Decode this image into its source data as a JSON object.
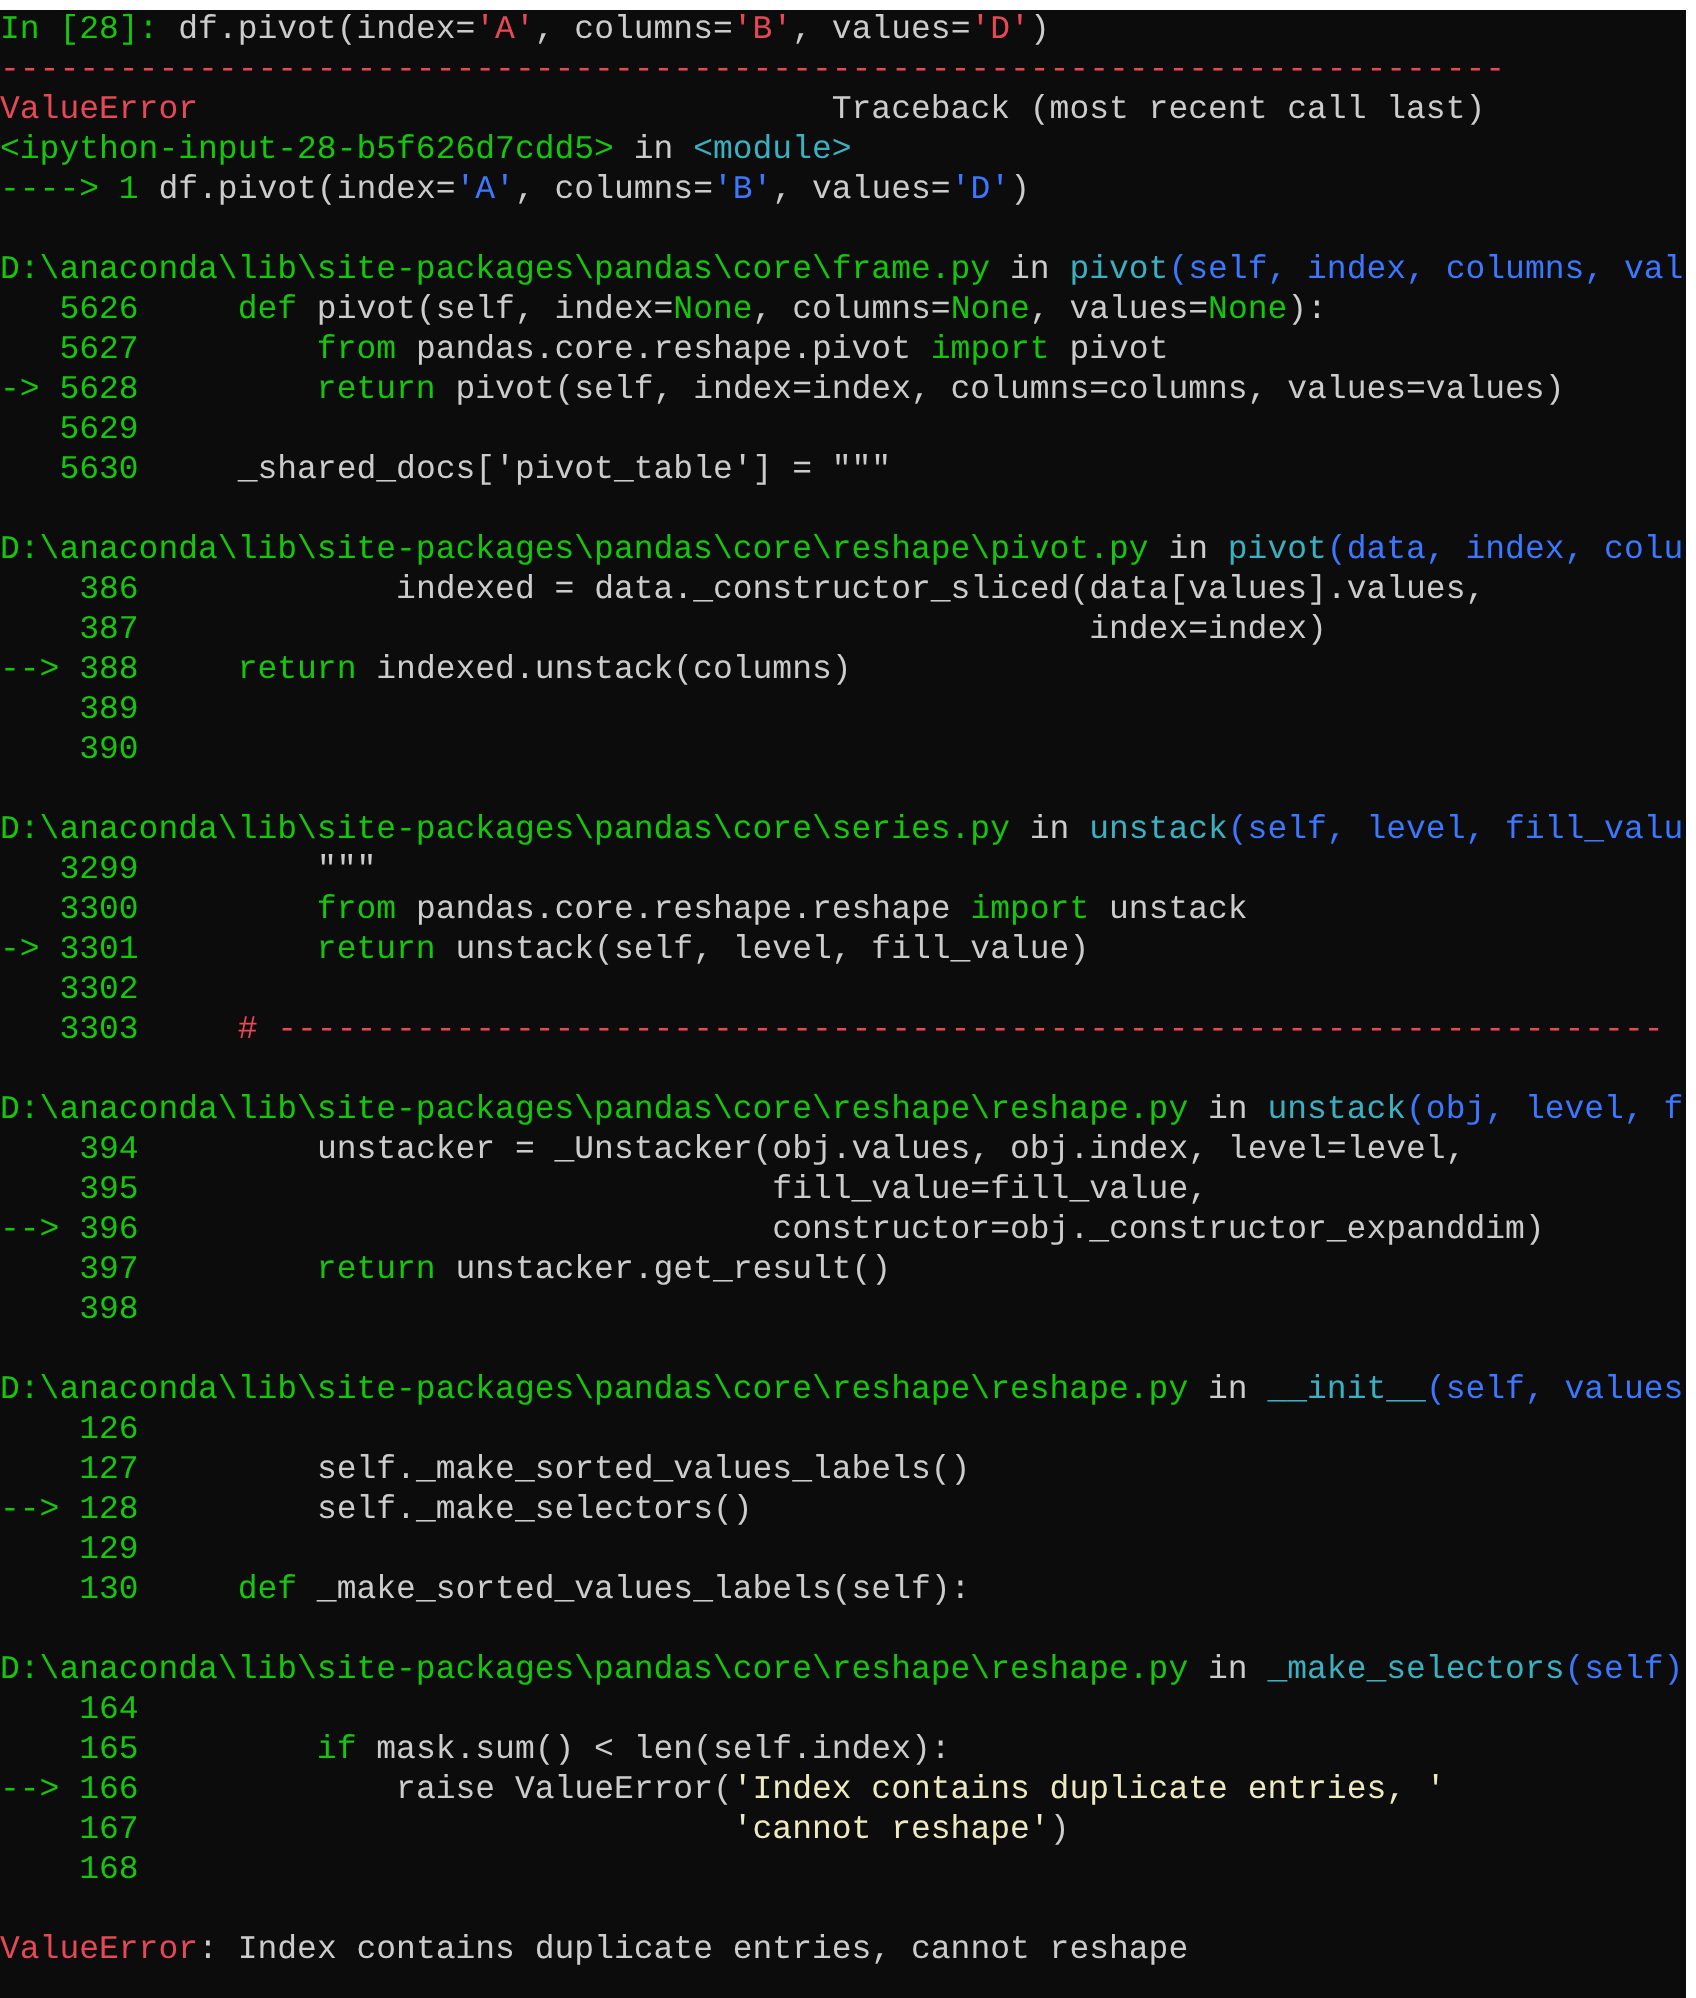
{
  "console": {
    "lines": [
      {
        "kind": "text",
        "segments": [
          {
            "kind": "prompt",
            "text": "In [28]: "
          },
          {
            "kind": "plain",
            "text": "df.pivot(index="
          },
          {
            "kind": "error",
            "text": "'A'"
          },
          {
            "kind": "plain",
            "text": ", columns="
          },
          {
            "kind": "error",
            "text": "'B'"
          },
          {
            "kind": "plain",
            "text": ", values="
          },
          {
            "kind": "error",
            "text": "'D'"
          },
          {
            "kind": "plain",
            "text": ")"
          }
        ]
      },
      {
        "kind": "text",
        "segments": [
          {
            "kind": "error",
            "text": "----------------------------------------------------------------------------"
          }
        ]
      },
      {
        "kind": "text",
        "segments": [
          {
            "kind": "error",
            "text": "ValueError"
          },
          {
            "kind": "plain",
            "text": "                                Traceback (most recent call last)"
          }
        ]
      },
      {
        "kind": "text",
        "segments": [
          {
            "kind": "path",
            "text": "<ipython-input-28-b5f626d7cdd5>"
          },
          {
            "kind": "plain",
            "text": " in "
          },
          {
            "kind": "function",
            "text": "<module>"
          }
        ]
      },
      {
        "kind": "text",
        "segments": [
          {
            "kind": "path",
            "text": "----> 1 "
          },
          {
            "kind": "plain",
            "text": "df.pivot(index="
          },
          {
            "kind": "args",
            "text": "'A'"
          },
          {
            "kind": "plain",
            "text": ", columns="
          },
          {
            "kind": "args",
            "text": "'B'"
          },
          {
            "kind": "plain",
            "text": ", values="
          },
          {
            "kind": "args",
            "text": "'D'"
          },
          {
            "kind": "plain",
            "text": ")"
          }
        ]
      },
      {
        "kind": "blank"
      },
      {
        "kind": "text",
        "segments": [
          {
            "kind": "path",
            "text": "D:\\anaconda\\lib\\site-packages\\pandas\\core\\frame.py"
          },
          {
            "kind": "plain",
            "text": " in "
          },
          {
            "kind": "function",
            "text": "pivot"
          },
          {
            "kind": "args",
            "text": "(self, index, columns, val"
          }
        ]
      },
      {
        "kind": "text",
        "segments": [
          {
            "kind": "path",
            "text": "   5626     def"
          },
          {
            "kind": "plain",
            "text": " pivot(self, index="
          },
          {
            "kind": "path",
            "text": "None"
          },
          {
            "kind": "plain",
            "text": ", columns="
          },
          {
            "kind": "path",
            "text": "None"
          },
          {
            "kind": "plain",
            "text": ", values="
          },
          {
            "kind": "path",
            "text": "None"
          },
          {
            "kind": "plain",
            "text": "):"
          }
        ]
      },
      {
        "kind": "text",
        "segments": [
          {
            "kind": "path",
            "text": "   5627         from"
          },
          {
            "kind": "plain",
            "text": " pandas.core.reshape.pivot "
          },
          {
            "kind": "path",
            "text": "import"
          },
          {
            "kind": "plain",
            "text": " pivot"
          }
        ]
      },
      {
        "kind": "text",
        "segments": [
          {
            "kind": "path",
            "text": "-> 5628         return"
          },
          {
            "kind": "plain",
            "text": " pivot(self, index=index, columns=columns, values=values)"
          }
        ]
      },
      {
        "kind": "text",
        "segments": [
          {
            "kind": "path",
            "text": "   5629"
          }
        ]
      },
      {
        "kind": "text",
        "segments": [
          {
            "kind": "path",
            "text": "   5630     "
          },
          {
            "kind": "plain",
            "text": "_shared_docs['pivot_table'] = \"\"\""
          }
        ]
      },
      {
        "kind": "blank"
      },
      {
        "kind": "text",
        "segments": [
          {
            "kind": "path",
            "text": "D:\\anaconda\\lib\\site-packages\\pandas\\core\\reshape\\pivot.py"
          },
          {
            "kind": "plain",
            "text": " in "
          },
          {
            "kind": "function",
            "text": "pivot"
          },
          {
            "kind": "args",
            "text": "(data, index, colu"
          }
        ]
      },
      {
        "kind": "text",
        "segments": [
          {
            "kind": "path",
            "text": "    386             "
          },
          {
            "kind": "plain",
            "text": "indexed = data._constructor_sliced(data[values].values,"
          }
        ]
      },
      {
        "kind": "text",
        "segments": [
          {
            "kind": "path",
            "text": "    387"
          },
          {
            "kind": "plain",
            "text": "                                                index=index)"
          }
        ]
      },
      {
        "kind": "text",
        "segments": [
          {
            "kind": "path",
            "text": "--> 388     return"
          },
          {
            "kind": "plain",
            "text": " indexed.unstack(columns)"
          }
        ]
      },
      {
        "kind": "text",
        "segments": [
          {
            "kind": "path",
            "text": "    389"
          }
        ]
      },
      {
        "kind": "text",
        "segments": [
          {
            "kind": "path",
            "text": "    390"
          }
        ]
      },
      {
        "kind": "blank"
      },
      {
        "kind": "text",
        "segments": [
          {
            "kind": "path",
            "text": "D:\\anaconda\\lib\\site-packages\\pandas\\core\\series.py"
          },
          {
            "kind": "plain",
            "text": " in "
          },
          {
            "kind": "function",
            "text": "unstack"
          },
          {
            "kind": "args",
            "text": "(self, level, fill_valu"
          }
        ]
      },
      {
        "kind": "text",
        "segments": [
          {
            "kind": "path",
            "text": "   3299         "
          },
          {
            "kind": "plain",
            "text": "\"\"\""
          }
        ]
      },
      {
        "kind": "text",
        "segments": [
          {
            "kind": "path",
            "text": "   3300         from"
          },
          {
            "kind": "plain",
            "text": " pandas.core.reshape.reshape "
          },
          {
            "kind": "path",
            "text": "import"
          },
          {
            "kind": "plain",
            "text": " unstack"
          }
        ]
      },
      {
        "kind": "text",
        "segments": [
          {
            "kind": "path",
            "text": "-> 3301         return"
          },
          {
            "kind": "plain",
            "text": " unstack(self, level, fill_value)"
          }
        ]
      },
      {
        "kind": "text",
        "segments": [
          {
            "kind": "path",
            "text": "   3302"
          }
        ]
      },
      {
        "kind": "text",
        "segments": [
          {
            "kind": "path",
            "text": "   3303     "
          },
          {
            "kind": "error",
            "text": "# ----------------------------------------------------------------------"
          }
        ]
      },
      {
        "kind": "blank"
      },
      {
        "kind": "text",
        "segments": [
          {
            "kind": "path",
            "text": "D:\\anaconda\\lib\\site-packages\\pandas\\core\\reshape\\reshape.py"
          },
          {
            "kind": "plain",
            "text": " in "
          },
          {
            "kind": "function",
            "text": "unstack"
          },
          {
            "kind": "args",
            "text": "(obj, level, f"
          }
        ]
      },
      {
        "kind": "text",
        "segments": [
          {
            "kind": "path",
            "text": "    394         "
          },
          {
            "kind": "plain",
            "text": "unstacker = _Unstacker(obj.values, obj.index, level=level,"
          }
        ]
      },
      {
        "kind": "text",
        "segments": [
          {
            "kind": "path",
            "text": "    395"
          },
          {
            "kind": "plain",
            "text": "                                fill_value=fill_value,"
          }
        ]
      },
      {
        "kind": "text",
        "segments": [
          {
            "kind": "path",
            "text": "--> 396"
          },
          {
            "kind": "plain",
            "text": "                                constructor=obj._constructor_expanddim)"
          }
        ]
      },
      {
        "kind": "text",
        "segments": [
          {
            "kind": "path",
            "text": "    397         return"
          },
          {
            "kind": "plain",
            "text": " unstacker.get_result()"
          }
        ]
      },
      {
        "kind": "text",
        "segments": [
          {
            "kind": "path",
            "text": "    398"
          }
        ]
      },
      {
        "kind": "blank"
      },
      {
        "kind": "text",
        "segments": [
          {
            "kind": "path",
            "text": "D:\\anaconda\\lib\\site-packages\\pandas\\core\\reshape\\reshape.py"
          },
          {
            "kind": "plain",
            "text": " in "
          },
          {
            "kind": "function",
            "text": "__init__"
          },
          {
            "kind": "args",
            "text": "(self, values"
          }
        ]
      },
      {
        "kind": "text",
        "segments": [
          {
            "kind": "path",
            "text": "    126"
          }
        ]
      },
      {
        "kind": "text",
        "segments": [
          {
            "kind": "path",
            "text": "    127         "
          },
          {
            "kind": "plain",
            "text": "self._make_sorted_values_labels()"
          }
        ]
      },
      {
        "kind": "text",
        "segments": [
          {
            "kind": "path",
            "text": "--> 128         "
          },
          {
            "kind": "plain",
            "text": "self._make_selectors()"
          }
        ]
      },
      {
        "kind": "text",
        "segments": [
          {
            "kind": "path",
            "text": "    129"
          }
        ]
      },
      {
        "kind": "text",
        "segments": [
          {
            "kind": "path",
            "text": "    130     def"
          },
          {
            "kind": "plain",
            "text": " _make_sorted_values_labels(self):"
          }
        ]
      },
      {
        "kind": "blank"
      },
      {
        "kind": "text",
        "segments": [
          {
            "kind": "path",
            "text": "D:\\anaconda\\lib\\site-packages\\pandas\\core\\reshape\\reshape.py"
          },
          {
            "kind": "plain",
            "text": " in "
          },
          {
            "kind": "function",
            "text": "_make_selectors"
          },
          {
            "kind": "args",
            "text": "(self)"
          }
        ]
      },
      {
        "kind": "text",
        "segments": [
          {
            "kind": "path",
            "text": "    164"
          }
        ]
      },
      {
        "kind": "text",
        "segments": [
          {
            "kind": "path",
            "text": "    165         if"
          },
          {
            "kind": "plain",
            "text": " mask.sum() < len(self.index):"
          }
        ]
      },
      {
        "kind": "text",
        "segments": [
          {
            "kind": "path",
            "text": "--> 166             "
          },
          {
            "kind": "plain",
            "text": "raise ValueError("
          },
          {
            "kind": "string",
            "text": "'Index contains duplicate entries, '"
          }
        ]
      },
      {
        "kind": "text",
        "segments": [
          {
            "kind": "path",
            "text": "    167                              "
          },
          {
            "kind": "string",
            "text": "'cannot reshape'"
          },
          {
            "kind": "plain",
            "text": ")"
          }
        ]
      },
      {
        "kind": "text",
        "segments": [
          {
            "kind": "path",
            "text": "    168"
          }
        ]
      },
      {
        "kind": "blank"
      },
      {
        "kind": "text",
        "segments": [
          {
            "kind": "error",
            "text": "ValueError"
          },
          {
            "kind": "plain",
            "text": ": Index contains duplicate entries, cannot reshape"
          }
        ]
      }
    ]
  }
}
